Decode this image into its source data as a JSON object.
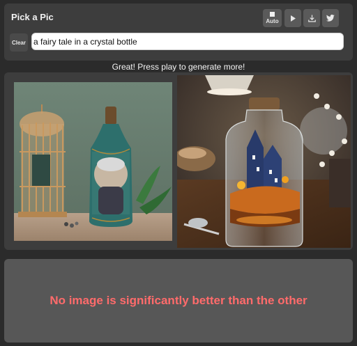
{
  "header": {
    "title": "Pick a Pic",
    "auto_label": "Auto",
    "icons": {
      "auto": "stop-square-icon",
      "play": "play-icon",
      "download": "download-icon",
      "share": "twitter-icon"
    }
  },
  "prompt": {
    "clear_label": "Clear",
    "value": "a fairy tale in a crystal bottle"
  },
  "status_text": "Great! Press play to generate more!",
  "images": {
    "left_subject": "birdcage-and-portrait-bottle-image",
    "right_subject": "crystal-bottle-castle-image"
  },
  "result_text": "No image is significantly better than the other",
  "colors": {
    "background": "#2b2b2b",
    "panel": "#3d3d3d",
    "result_panel": "#575757",
    "result_text": "#ff6b6b"
  }
}
